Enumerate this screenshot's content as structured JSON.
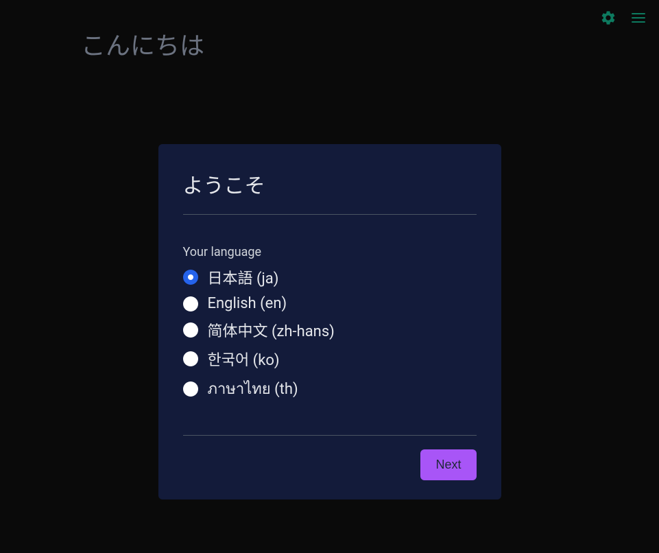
{
  "header": {
    "greeting": "こんにちは"
  },
  "card": {
    "title": "ようこそ",
    "field_label": "Your language",
    "languages": [
      {
        "label": "日本語 (ja)",
        "selected": true
      },
      {
        "label": "English (en)",
        "selected": false
      },
      {
        "label": "简体中文 (zh-hans)",
        "selected": false
      },
      {
        "label": "한국어 (ko)",
        "selected": false
      },
      {
        "label": "ภาษาไทย (th)",
        "selected": false
      }
    ],
    "next_label": "Next"
  },
  "icons": {
    "settings": "gear-icon",
    "menu": "hamburger-icon"
  }
}
